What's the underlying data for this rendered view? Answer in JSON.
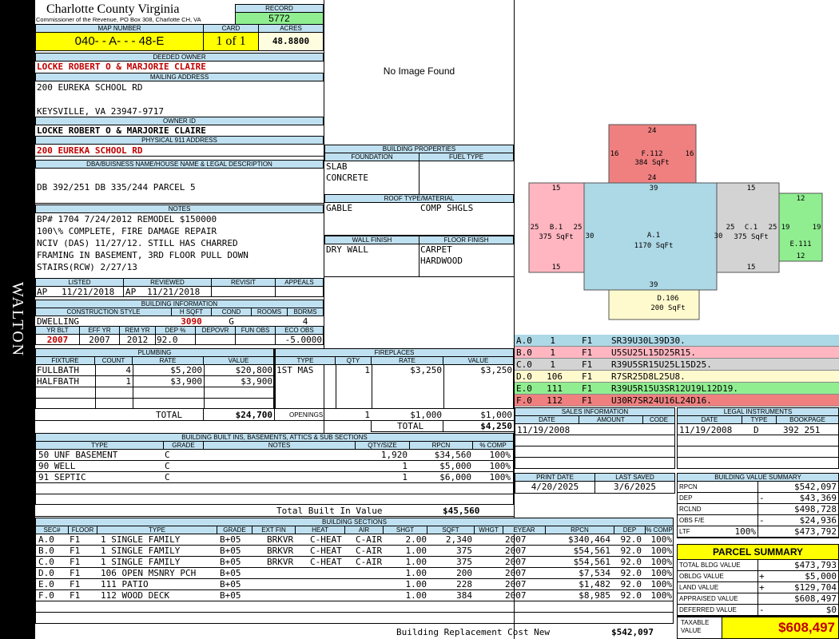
{
  "county": "Charlotte County Virginia",
  "commissioner": "Commissioner of the Revenue, PO Box 308, Charlotte CH, VA",
  "side_label": "WALTON",
  "record": {
    "label": "RECORD",
    "value": "5772"
  },
  "map_number": {
    "label": "MAP NUMBER",
    "value": "040- - A- - - 48-E"
  },
  "card": {
    "label": "CARD",
    "value": "1 of 1"
  },
  "acres": {
    "label": "ACRES",
    "value": "48.8800"
  },
  "deeded_owner": {
    "label": "DEEDED OWNER",
    "value": "LOCKE ROBERT O & MARJORIE CLAIRE"
  },
  "mailing": {
    "label": "MAILING ADDRESS",
    "line1": "200 EUREKA SCHOOL RD",
    "line2": "KEYSVILLE, VA 23947-9717"
  },
  "owner_id": {
    "label": "OWNER ID",
    "value": "LOCKE ROBERT O & MARJORIE CLAIRE"
  },
  "physical": {
    "label": "PHYSICAL 911 ADDRESS",
    "value": "200 EUREKA SCHOOL RD"
  },
  "legal": {
    "label": "DBA/BUISNESS NAME/HOUSE NAME & LEGAL DESCRIPTION",
    "value": "DB 392/251 DB 335/244 PARCEL 5"
  },
  "notes": {
    "label": "NOTES",
    "lines": [
      "BP# 1704 7/24/2012 REMODEL $150000",
      "100\\% COMPLETE, FIRE DAMAGE REPAIR",
      "NCIV (DAS) 11/27/12. STILL HAS CHARRED",
      "FRAMING IN BASEMENT, 3RD FLOOR PULL DOWN",
      "STAIRS(RCW) 2/27/13"
    ]
  },
  "review": {
    "listed_label": "LISTED",
    "reviewed_label": "REVIEWED",
    "revisit_label": "REVISIT",
    "appeals_label": "APPEALS",
    "listed_by": "AP",
    "listed_date": "11/21/2018",
    "reviewed_by": "AP",
    "reviewed_date": "11/21/2018"
  },
  "no_image": "No Image Found",
  "building_info": {
    "label": "BUILDING INFORMATION",
    "h_construction": "CONSTRUCTION STYLE",
    "h_hsqft": "H SQFT",
    "h_cond": "COND",
    "h_rooms": "ROOMS",
    "h_bdrms": "BDRMS",
    "construction": "DWELLING",
    "hsqft": "3090",
    "cond": "G",
    "rooms": "",
    "bdrms": "4",
    "h_yrblt": "YR BLT",
    "h_effyr": "EFF YR",
    "h_remyr": "REM YR",
    "h_dep": "DEP %",
    "h_depovr": "DEPOVR",
    "h_funobs": "FUN OBS",
    "h_ecoobs": "ECO OBS",
    "yrblt": "2007",
    "effyr": "2007",
    "remyr": "2012",
    "dep": "92.0",
    "depovr": "",
    "funobs": "",
    "ecoobs": "-5.0000"
  },
  "building_props": {
    "label": "BUILDING PROPERTIES",
    "foundation_label": "FOUNDATION",
    "fuel_label": "FUEL TYPE",
    "foundation": [
      "SLAB",
      "CONCRETE"
    ],
    "roof_label": "ROOF TYPE/MATERIAL",
    "roof_type": "GABLE",
    "roof_material": "COMP SHGLS",
    "wall_label": "WALL FINISH",
    "floor_label": "FLOOR FINISH",
    "wall": "DRY WALL",
    "floor": [
      "CARPET",
      "HARDWOOD"
    ]
  },
  "sketch": {
    "areas": [
      {
        "name": "F.112",
        "area": "384 SqFt",
        "top": "24",
        "bottom": "24",
        "left": "16",
        "right": "16"
      },
      {
        "name": "B.1",
        "area": "375 SqFt",
        "top": "15",
        "bottom": "15",
        "left": "25",
        "right": "25"
      },
      {
        "name": "A.1",
        "area": "1170 SqFt",
        "top": "39",
        "bottom": "39",
        "left": "30",
        "right": "30"
      },
      {
        "name": "C.1",
        "area": "375 SqFt",
        "top": "15",
        "bottom": "15",
        "left": "25",
        "right": "25"
      },
      {
        "name": "E.111",
        "area": "",
        "top": "12",
        "bottom": "12",
        "left": "19",
        "right": "19"
      },
      {
        "name": "D.106",
        "area": "200 SqFt"
      }
    ]
  },
  "sketch_legend": [
    {
      "code": "A.0",
      "num": "1",
      "floor": "F1",
      "desc": "SR39U30L39D30.",
      "color": "#add8e6"
    },
    {
      "code": "B.0",
      "num": "1",
      "floor": "F1",
      "desc": "U5SU25L15D25R15.",
      "color": "#ffb6c1"
    },
    {
      "code": "C.0",
      "num": "1",
      "floor": "F1",
      "desc": "R39U5SR15U25L15D25.",
      "color": "#d3d3d3"
    },
    {
      "code": "D.0",
      "num": "106",
      "floor": "F1",
      "desc": "R7SR25D8L25U8.",
      "color": "#fffacd"
    },
    {
      "code": "E.0",
      "num": "111",
      "floor": "F1",
      "desc": "R39U5R15U3SR12U19L12D19.",
      "color": "#90ee90"
    },
    {
      "code": "F.0",
      "num": "112",
      "floor": "F1",
      "desc": "U30R7SR24U16L24D16.",
      "color": "#f08080"
    }
  ],
  "plumbing": {
    "label": "PLUMBING",
    "h_fixture": "FIXTURE",
    "h_count": "COUNT",
    "h_rate": "RATE",
    "h_value": "VALUE",
    "rows": [
      {
        "fixture": "FULLBATH",
        "count": "4",
        "rate": "$5,200",
        "value": "$20,800"
      },
      {
        "fixture": "HALFBATH",
        "count": "1",
        "rate": "$3,900",
        "value": "$3,900"
      }
    ],
    "total_label": "TOTAL",
    "total": "$24,700"
  },
  "fireplaces": {
    "label": "FIREPLACES",
    "h_type": "TYPE",
    "h_qty": "QTY",
    "h_rate": "RATE",
    "h_value": "VALUE",
    "rows": [
      {
        "type": "1ST MAS",
        "qty": "1",
        "rate": "$3,250",
        "value": "$3,250"
      }
    ],
    "openings_label": "OPENINGS",
    "openings_qty": "1",
    "openings_rate": "$1,000",
    "openings_value": "$1,000",
    "total_label": "TOTAL",
    "total": "$4,250"
  },
  "sales": {
    "label": "SALES INFORMATION",
    "h_date": "DATE",
    "h_amount": "AMOUNT",
    "h_code": "CODE",
    "rows": [
      {
        "date": "11/19/2008",
        "amount": "",
        "code": ""
      }
    ]
  },
  "legal_instr": {
    "label": "LEGAL INSTRUMENTS",
    "h_date": "DATE",
    "h_type": "TYPE",
    "h_book": "BOOKPAGE",
    "rows": [
      {
        "date": "11/19/2008",
        "type": "D",
        "book": "392 251"
      }
    ]
  },
  "builtins": {
    "label": "BUILDING BUILT INS, BASEMENTS, ATTICS & SUB SECTIONS",
    "h_type": "TYPE",
    "h_grade": "GRADE",
    "h_notes": "NOTES",
    "h_qty": "QTY/SIZE",
    "h_rpcn": "RPCN",
    "h_comp": "% COMP",
    "rows": [
      {
        "type": "50 UNF BASEMENT",
        "grade": "C",
        "notes": "",
        "qty": "1,920",
        "rpcn": "$34,560",
        "comp": "100%"
      },
      {
        "type": "90 WELL",
        "grade": "C",
        "notes": "",
        "qty": "1",
        "rpcn": "$5,000",
        "comp": "100%"
      },
      {
        "type": "91 SEPTIC",
        "grade": "C",
        "notes": "",
        "qty": "1",
        "rpcn": "$6,000",
        "comp": "100%"
      }
    ],
    "total_label": "Total Built In Value",
    "total": "$45,560"
  },
  "dates": {
    "print_label": "PRINT DATE",
    "saved_label": "LAST SAVED",
    "print": "4/20/2025",
    "saved": "3/6/2025"
  },
  "value_summary": {
    "label": "BUILDING VALUE SUMMARY",
    "rows": [
      {
        "label": "RPCN",
        "sign": "",
        "pct": "",
        "value": "$542,097"
      },
      {
        "label": "DEP",
        "sign": "-",
        "pct": "",
        "value": "$43,369"
      },
      {
        "label": "RCLND",
        "sign": "",
        "pct": "",
        "value": "$498,728"
      },
      {
        "label": "OBS F/E",
        "sign": "-",
        "pct": "",
        "value": "$24,936"
      },
      {
        "label": "LTF",
        "sign": "",
        "pct": "100%",
        "value": "$473,792"
      }
    ]
  },
  "parcel_summary": {
    "label": "PARCEL SUMMARY",
    "rows": [
      {
        "label": "TOTAL BLDG VALUE",
        "sign": "",
        "value": "$473,793"
      },
      {
        "label": "OBLDG VALUE",
        "sign": "+",
        "value": "$5,000"
      },
      {
        "label": "LAND VALUE",
        "sign": "+",
        "value": "$129,704"
      },
      {
        "label": "APPRAISED VALUE",
        "sign": "",
        "value": "$608,497"
      },
      {
        "label": "DEFERRED VALUE",
        "sign": "-",
        "value": "$0"
      }
    ],
    "taxable_label": "TAXABLE VALUE",
    "taxable": "$608,497"
  },
  "sections": {
    "label": "BUILDING SECTIONS",
    "headers": [
      "SEC#",
      "FLOOR",
      "TYPE",
      "GRADE",
      "EXT FIN",
      "HEAT",
      "AIR",
      "SHGT",
      "SQFT",
      "WHGT",
      "EYEAR",
      "RPCN",
      "DEP",
      "% COMP"
    ],
    "rows": [
      {
        "sec": "A.0",
        "floor": "F1",
        "type": "1 SINGLE FAMILY",
        "grade": "B+05",
        "ext": "BRKVR",
        "heat": "C-HEAT",
        "air": "C-AIR",
        "shgt": "2.00",
        "sqft": "2,340",
        "whgt": "",
        "eyear": "2007",
        "rpcn": "$340,464",
        "dep": "92.0",
        "comp": "100%"
      },
      {
        "sec": "B.0",
        "floor": "F1",
        "type": "1 SINGLE FAMILY",
        "grade": "B+05",
        "ext": "BRKVR",
        "heat": "C-HEAT",
        "air": "C-AIR",
        "shgt": "1.00",
        "sqft": "375",
        "whgt": "",
        "eyear": "2007",
        "rpcn": "$54,561",
        "dep": "92.0",
        "comp": "100%"
      },
      {
        "sec": "C.0",
        "floor": "F1",
        "type": "1 SINGLE FAMILY",
        "grade": "B+05",
        "ext": "BRKVR",
        "heat": "C-HEAT",
        "air": "C-AIR",
        "shgt": "1.00",
        "sqft": "375",
        "whgt": "",
        "eyear": "2007",
        "rpcn": "$54,561",
        "dep": "92.0",
        "comp": "100%"
      },
      {
        "sec": "D.0",
        "floor": "F1",
        "type": "106 OPEN MSNRY PCH",
        "grade": "B+05",
        "ext": "",
        "heat": "",
        "air": "",
        "shgt": "1.00",
        "sqft": "200",
        "whgt": "",
        "eyear": "2007",
        "rpcn": "$7,534",
        "dep": "92.0",
        "comp": "100%"
      },
      {
        "sec": "E.0",
        "floor": "F1",
        "type": "111 PATIO",
        "grade": "B+05",
        "ext": "",
        "heat": "",
        "air": "",
        "shgt": "1.00",
        "sqft": "228",
        "whgt": "",
        "eyear": "2007",
        "rpcn": "$1,482",
        "dep": "92.0",
        "comp": "100%"
      },
      {
        "sec": "F.0",
        "floor": "F1",
        "type": "112 WOOD DECK",
        "grade": "B+05",
        "ext": "",
        "heat": "",
        "air": "",
        "shgt": "1.00",
        "sqft": "384",
        "whgt": "",
        "eyear": "2007",
        "rpcn": "$8,985",
        "dep": "92.0",
        "comp": "100%"
      }
    ],
    "total_label": "Building Replacement Cost New",
    "total": "$542,097"
  }
}
